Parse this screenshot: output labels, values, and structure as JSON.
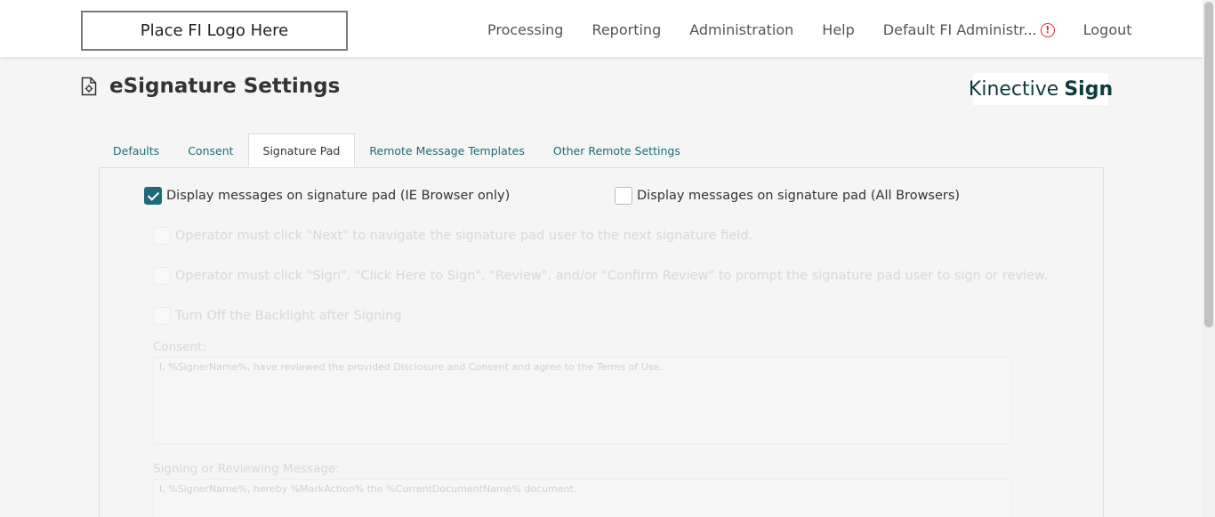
{
  "header": {
    "logo_text": "Place FI Logo Here",
    "nav": {
      "processing": "Processing",
      "reporting": "Reporting",
      "administration": "Administration",
      "help": "Help",
      "user": "Default FI Administr...",
      "alert_symbol": "!",
      "logout": "Logout"
    }
  },
  "page": {
    "title": "eSignature Settings",
    "brand_light": "Kinective",
    "brand_bold": "Sign"
  },
  "tabs": [
    {
      "label": "Defaults",
      "active": false
    },
    {
      "label": "Consent",
      "active": false
    },
    {
      "label": "Signature Pad",
      "active": true
    },
    {
      "label": "Remote Message Templates",
      "active": false
    },
    {
      "label": "Other Remote Settings",
      "active": false
    }
  ],
  "signature_pad": {
    "ie_only_label": "Display messages on signature pad (IE Browser only)",
    "ie_only_checked": true,
    "all_browsers_label": "Display messages on signature pad (All Browsers)",
    "all_browsers_checked": false,
    "operator_next_label": "Operator must click \"Next\" to navigate the signature pad user to the next signature field.",
    "operator_sign_label": "Operator must click \"Sign\", \"Click Here to Sign\", \"Review\", and/or \"Confirm Review\" to prompt the signature pad user to sign or review.",
    "backlight_label": "Turn Off the Backlight after Signing",
    "consent_label": "Consent:",
    "consent_text": "I, %SignerName%, have reviewed the provided Disclosure and Consent and agree to the Terms of Use.",
    "signing_label": "Signing or Reviewing Message:",
    "signing_text": "I, %SignerName%, hereby %MarkAction% the %CurrentDocumentName% document."
  },
  "colors": {
    "accent": "#1e6b7a",
    "tab_link": "#1a6d74",
    "alert": "#d32f2f",
    "brand": "#0e3b3e"
  }
}
